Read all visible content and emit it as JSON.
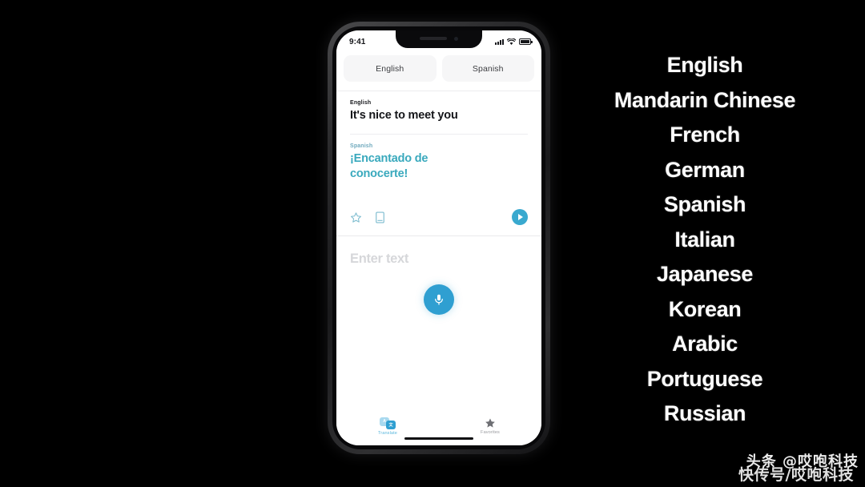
{
  "background_color": "#000000",
  "phone": {
    "status_bar": {
      "time": "9:41",
      "icons": [
        "cellular-signal-icon",
        "wifi-icon",
        "battery-icon"
      ]
    },
    "language_picker": {
      "source_button": "English",
      "target_button": "Spanish"
    },
    "translation_card": {
      "source_label": "English",
      "source_text": "It's nice to meet you",
      "target_label": "Spanish",
      "target_text": "¡Encantado de conocerte!",
      "target_color": "#39a9bd",
      "actions": [
        "star-icon",
        "dictionary-icon",
        "play-audio-button"
      ]
    },
    "compose": {
      "placeholder": "Enter text",
      "mic_button": "microphone-button",
      "mic_color": "#2f9fd1"
    },
    "tab_bar": {
      "tabs": [
        {
          "label": "Translate",
          "icon": "translate-bubbles-icon",
          "active": true
        },
        {
          "label": "Favorites",
          "icon": "star-filled-icon",
          "active": false
        }
      ]
    }
  },
  "language_list": {
    "items": [
      "English",
      "Mandarin Chinese",
      "French",
      "German",
      "Spanish",
      "Italian",
      "Japanese",
      "Korean",
      "Arabic",
      "Portuguese",
      "Russian"
    ],
    "text_color": "#ffffff"
  },
  "watermark": {
    "line1": "头条 @哎咆科技",
    "line2": "快传号/哎咆科技"
  }
}
